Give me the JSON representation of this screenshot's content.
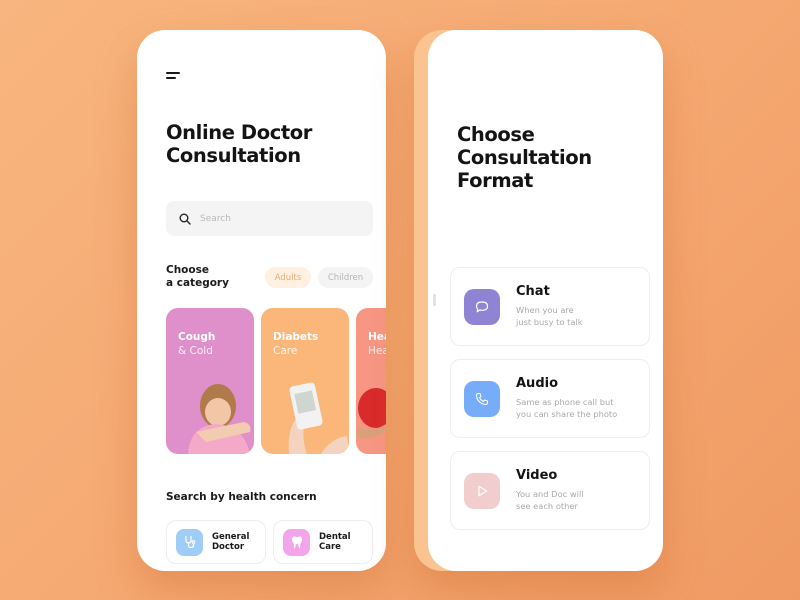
{
  "left_screen": {
    "title": "Online Doctor Consultation",
    "search": {
      "placeholder": "Search",
      "value": ""
    },
    "category": {
      "label": "Choose a category",
      "label_line1": "Choose",
      "label_line2": "a category",
      "filters": [
        {
          "label": "Adults",
          "active": true
        },
        {
          "label": "Children",
          "active": false
        }
      ],
      "cards": [
        {
          "title": "Cough",
          "subtitle": "& Cold",
          "color": "#df8fca",
          "image": "girl-coughing"
        },
        {
          "title": "Diabets",
          "subtitle": "Care",
          "color": "#fbb679",
          "image": "glucose-meter"
        },
        {
          "title": "Heart",
          "subtitle": "Health",
          "color": "#f69683",
          "image": "red-heart"
        }
      ]
    },
    "concern": {
      "title": "Search by health concern",
      "items": [
        {
          "label_line1": "General",
          "label_line2": "Doctor",
          "icon": "stethoscope-icon",
          "color": "#9fcdf8"
        },
        {
          "label_line1": "Dental",
          "label_line2": "Care",
          "icon": "tooth-icon",
          "color": "#f2a5ea"
        }
      ]
    }
  },
  "right_screen": {
    "title_line1": "Choose",
    "title_line2": "Consultation",
    "title_line3": "Format",
    "formats": [
      {
        "name": "Chat",
        "desc_line1": "When you are",
        "desc_line2": "just busy to talk",
        "icon": "chat-bubble-icon",
        "color": "#8f84d4"
      },
      {
        "name": "Audio",
        "desc_line1": "Same as phone call but",
        "desc_line2": "you can share the photo",
        "icon": "phone-icon",
        "color": "#76acf8"
      },
      {
        "name": "Video",
        "desc_line1": "You and Doc will",
        "desc_line2": "see each other",
        "icon": "play-icon",
        "color": "#f2cdcd"
      }
    ]
  }
}
